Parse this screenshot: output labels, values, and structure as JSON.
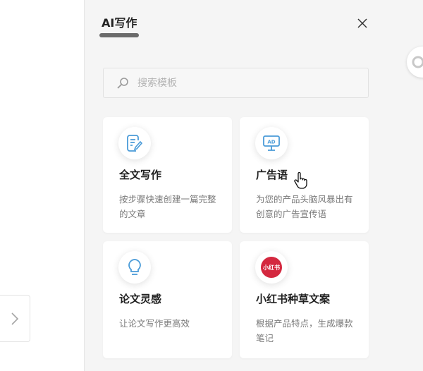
{
  "panel": {
    "title": "AI写作"
  },
  "search": {
    "placeholder": "搜索模板",
    "value": ""
  },
  "cards": [
    {
      "title": "全文写作",
      "desc": "按步骤快速创建一篇完整的文章",
      "icon": "document-edit-icon"
    },
    {
      "title": "广告语",
      "desc": "为您的产品头脑风暴出有创意的广告宣传语",
      "icon": "ad-board-icon"
    },
    {
      "title": "论文灵感",
      "desc": "让论文写作更高效",
      "icon": "lightbulb-icon"
    },
    {
      "title": "小红书种草文案",
      "desc": "根据产品特点，生成爆款笔记",
      "icon": "xiaohongshu-logo",
      "badge": "小红书"
    }
  ],
  "colors": {
    "accent_blue": "#4a9bd8",
    "xhs_red": "#d4283f"
  }
}
